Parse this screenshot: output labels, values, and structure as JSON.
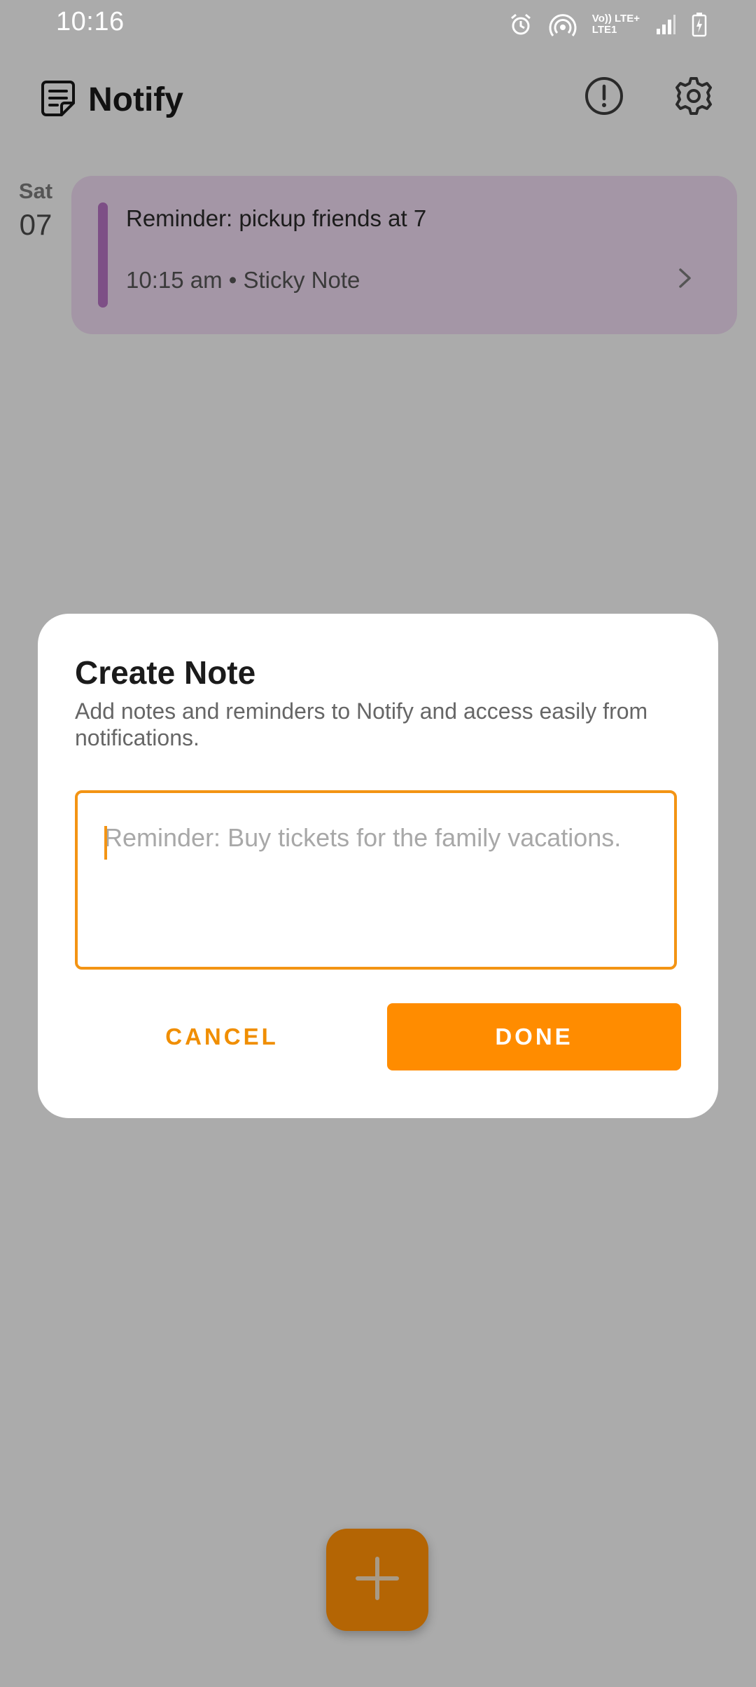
{
  "status_bar": {
    "time": "10:16",
    "network_top": "Vo)) LTE+",
    "network_bottom": "LTE1",
    "icons": [
      "alarm-icon",
      "hotspot-icon",
      "signal-icon",
      "battery-icon"
    ]
  },
  "app_bar": {
    "title": "Notify",
    "icons": [
      "note-logo-icon",
      "info-icon",
      "settings-icon"
    ]
  },
  "notes": [
    {
      "date_day": "Sat",
      "date_num": "07",
      "text": "Reminder: pickup friends at 7",
      "meta": "10:15 am • Sticky Note"
    }
  ],
  "dialog": {
    "title": "Create Note",
    "subtitle": "Add notes and reminders to Notify and access easily from notifications.",
    "input_value": "",
    "input_placeholder": "Reminder: Buy tickets for the family vacations.",
    "cancel_label": "CANCEL",
    "done_label": "DONE"
  },
  "fab": {
    "icon": "plus-icon"
  },
  "colors": {
    "accent": "#ff8c00",
    "scrim_background": "#ababab",
    "note_card": "#a496a6",
    "note_accent": "#7d4f86",
    "fab": "#b46504"
  }
}
